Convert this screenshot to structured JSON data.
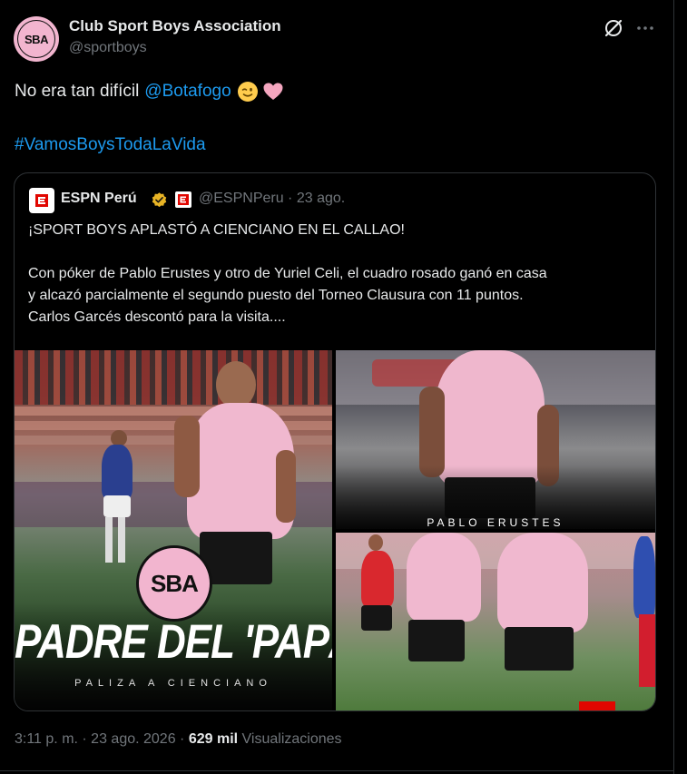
{
  "author": {
    "name": "Club Sport Boys Association",
    "handle": "@sportboys",
    "avatar_text": "SBA",
    "avatar_color": "#f2b5cf"
  },
  "header_icons": [
    "grok-icon",
    "more-options-icon"
  ],
  "tweet": {
    "text": "No era tan difícil",
    "mention": "@Botafogo",
    "emojis": [
      "winking-face-emoji",
      "pink-heart-emoji"
    ],
    "hashtag": "#VamosBoysTodaLaVida"
  },
  "quote": {
    "author_name": "ESPN Perú",
    "author_handle_date": "@ESPNPeru · 23 ago.",
    "logo_letter": "E",
    "logo_color": "#e10600",
    "verified_badge_color": "#e8b425",
    "title": "¡SPORT BOYS APLASTÓ A CIENCIANO EN EL CALLAO!",
    "body_lines": [
      "Con póker de Pablo Erustes y otro de Yuriel Celi, el cuadro rosado ganó en casa",
      "y alcazó parcialmente el segundo puesto del Torneo Clausura con 11 puntos.",
      "Carlos Garcés descontó para la visita...."
    ],
    "media": {
      "main_badge": "SBA",
      "main_headline": "PADRE DEL 'PAPÁ'",
      "main_subline": "PALIZA A CIENCIANO",
      "top_right_caption": "PABLO ERUSTES"
    }
  },
  "meta": {
    "time_date": "3:11 p. m. · 23 ago. 2026 · ",
    "views_count": "629 mil",
    "views_label": "Visualizaciones"
  },
  "colors": {
    "background": "#000000",
    "text": "#e7e9ea",
    "muted": "#71767b",
    "link": "#1d9bf0",
    "border": "#2f3336"
  }
}
